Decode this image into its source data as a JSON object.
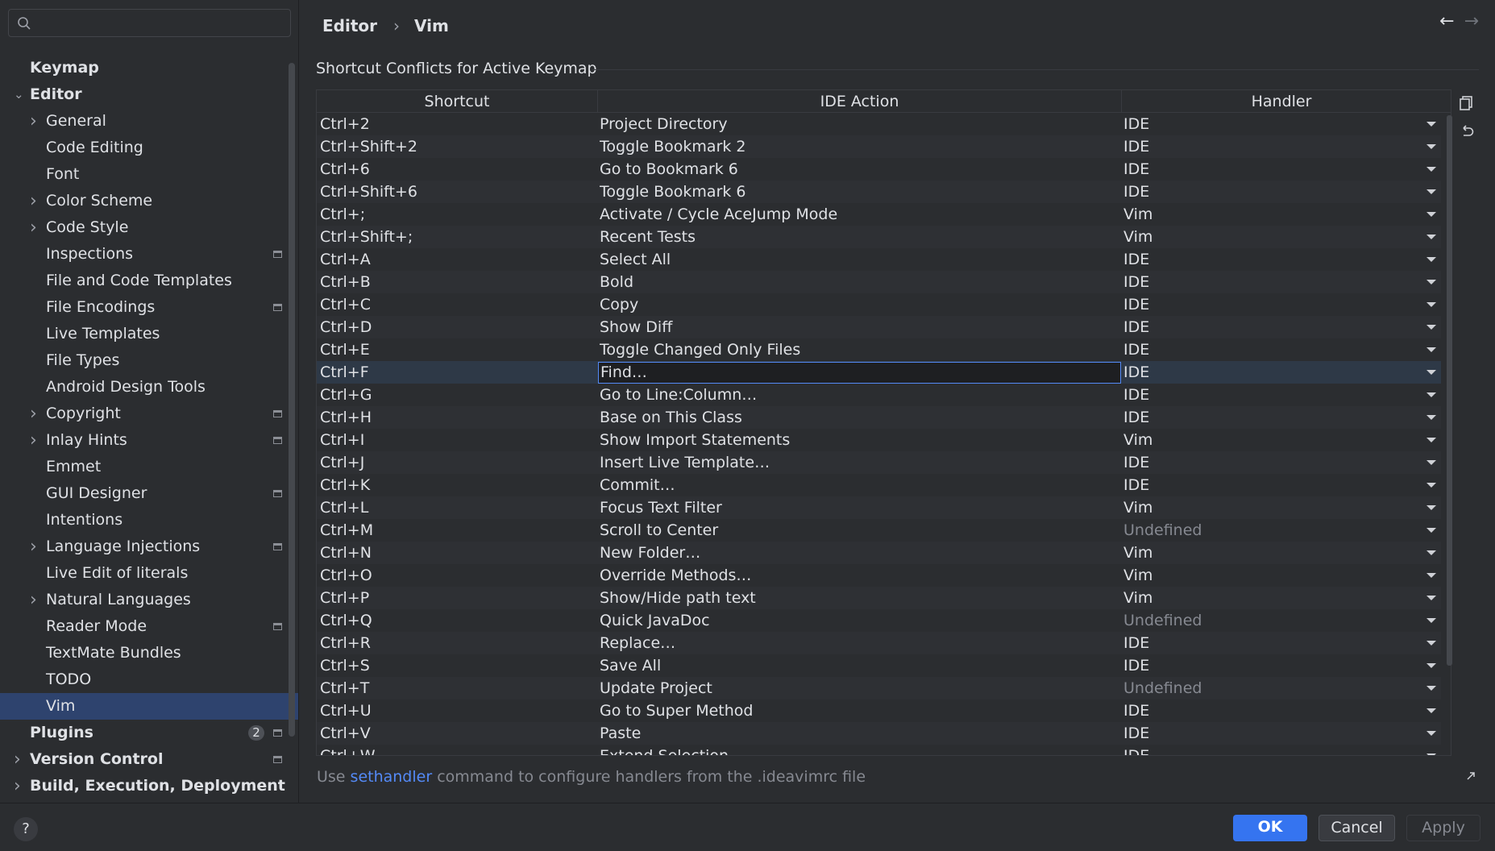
{
  "search": {
    "placeholder": ""
  },
  "sidebar": {
    "items": [
      {
        "label": "Keymap",
        "bold": true,
        "indent": 0,
        "chevron": "",
        "project_icon": false,
        "badge": ""
      },
      {
        "label": "Editor",
        "bold": true,
        "indent": 0,
        "chevron": "expanded",
        "project_icon": false,
        "badge": ""
      },
      {
        "label": "General",
        "bold": false,
        "indent": 1,
        "chevron": "collapsed",
        "project_icon": false,
        "badge": ""
      },
      {
        "label": "Code Editing",
        "bold": false,
        "indent": 1,
        "chevron": "",
        "project_icon": false,
        "badge": ""
      },
      {
        "label": "Font",
        "bold": false,
        "indent": 1,
        "chevron": "",
        "project_icon": false,
        "badge": ""
      },
      {
        "label": "Color Scheme",
        "bold": false,
        "indent": 1,
        "chevron": "collapsed",
        "project_icon": false,
        "badge": ""
      },
      {
        "label": "Code Style",
        "bold": false,
        "indent": 1,
        "chevron": "collapsed",
        "project_icon": false,
        "badge": ""
      },
      {
        "label": "Inspections",
        "bold": false,
        "indent": 1,
        "chevron": "",
        "project_icon": true,
        "badge": ""
      },
      {
        "label": "File and Code Templates",
        "bold": false,
        "indent": 1,
        "chevron": "",
        "project_icon": false,
        "badge": ""
      },
      {
        "label": "File Encodings",
        "bold": false,
        "indent": 1,
        "chevron": "",
        "project_icon": true,
        "badge": ""
      },
      {
        "label": "Live Templates",
        "bold": false,
        "indent": 1,
        "chevron": "",
        "project_icon": false,
        "badge": ""
      },
      {
        "label": "File Types",
        "bold": false,
        "indent": 1,
        "chevron": "",
        "project_icon": false,
        "badge": ""
      },
      {
        "label": "Android Design Tools",
        "bold": false,
        "indent": 1,
        "chevron": "",
        "project_icon": false,
        "badge": ""
      },
      {
        "label": "Copyright",
        "bold": false,
        "indent": 1,
        "chevron": "collapsed",
        "project_icon": true,
        "badge": ""
      },
      {
        "label": "Inlay Hints",
        "bold": false,
        "indent": 1,
        "chevron": "collapsed",
        "project_icon": true,
        "badge": ""
      },
      {
        "label": "Emmet",
        "bold": false,
        "indent": 1,
        "chevron": "",
        "project_icon": false,
        "badge": ""
      },
      {
        "label": "GUI Designer",
        "bold": false,
        "indent": 1,
        "chevron": "",
        "project_icon": true,
        "badge": ""
      },
      {
        "label": "Intentions",
        "bold": false,
        "indent": 1,
        "chevron": "",
        "project_icon": false,
        "badge": ""
      },
      {
        "label": "Language Injections",
        "bold": false,
        "indent": 1,
        "chevron": "collapsed",
        "project_icon": true,
        "badge": ""
      },
      {
        "label": "Live Edit of literals",
        "bold": false,
        "indent": 1,
        "chevron": "",
        "project_icon": false,
        "badge": ""
      },
      {
        "label": "Natural Languages",
        "bold": false,
        "indent": 1,
        "chevron": "collapsed",
        "project_icon": false,
        "badge": ""
      },
      {
        "label": "Reader Mode",
        "bold": false,
        "indent": 1,
        "chevron": "",
        "project_icon": true,
        "badge": ""
      },
      {
        "label": "TextMate Bundles",
        "bold": false,
        "indent": 1,
        "chevron": "",
        "project_icon": false,
        "badge": ""
      },
      {
        "label": "TODO",
        "bold": false,
        "indent": 1,
        "chevron": "",
        "project_icon": false,
        "badge": ""
      },
      {
        "label": "Vim",
        "bold": false,
        "indent": 1,
        "chevron": "",
        "project_icon": false,
        "badge": "",
        "selected": true
      },
      {
        "label": "Plugins",
        "bold": true,
        "indent": 0,
        "chevron": "",
        "project_icon": true,
        "badge": "2"
      },
      {
        "label": "Version Control",
        "bold": true,
        "indent": 0,
        "chevron": "collapsed",
        "project_icon": true,
        "badge": ""
      },
      {
        "label": "Build, Execution, Deployment",
        "bold": true,
        "indent": 0,
        "chevron": "collapsed",
        "project_icon": false,
        "badge": ""
      }
    ]
  },
  "breadcrumb": {
    "parent": "Editor",
    "separator": "›",
    "current": "Vim"
  },
  "nav": {
    "back": "←",
    "forward": "→"
  },
  "section": {
    "title": "Shortcut Conflicts for Active Keymap"
  },
  "table": {
    "headers": [
      "Shortcut",
      "IDE Action",
      "Handler"
    ],
    "rows": [
      {
        "shortcut": "Ctrl+2",
        "action": "Project Directory",
        "handler": "IDE"
      },
      {
        "shortcut": "Ctrl+Shift+2",
        "action": "Toggle Bookmark 2",
        "handler": "IDE"
      },
      {
        "shortcut": "Ctrl+6",
        "action": "Go to Bookmark 6",
        "handler": "IDE"
      },
      {
        "shortcut": "Ctrl+Shift+6",
        "action": "Toggle Bookmark 6",
        "handler": "IDE"
      },
      {
        "shortcut": "Ctrl+;",
        "action": "Activate / Cycle AceJump Mode",
        "handler": "Vim"
      },
      {
        "shortcut": "Ctrl+Shift+;",
        "action": "Recent Tests",
        "handler": "Vim"
      },
      {
        "shortcut": "Ctrl+A",
        "action": "Select All",
        "handler": "IDE"
      },
      {
        "shortcut": "Ctrl+B",
        "action": "Bold",
        "handler": "IDE"
      },
      {
        "shortcut": "Ctrl+C",
        "action": "Copy",
        "handler": "IDE"
      },
      {
        "shortcut": "Ctrl+D",
        "action": "Show Diff",
        "handler": "IDE"
      },
      {
        "shortcut": "Ctrl+E",
        "action": "Toggle Changed Only Files",
        "handler": "IDE"
      },
      {
        "shortcut": "Ctrl+F",
        "action": "Find…",
        "handler": "IDE",
        "selected": true
      },
      {
        "shortcut": "Ctrl+G",
        "action": "Go to Line:Column…",
        "handler": "IDE"
      },
      {
        "shortcut": "Ctrl+H",
        "action": "Base on This Class",
        "handler": "IDE"
      },
      {
        "shortcut": "Ctrl+I",
        "action": "Show Import Statements",
        "handler": "Vim"
      },
      {
        "shortcut": "Ctrl+J",
        "action": "Insert Live Template…",
        "handler": "IDE"
      },
      {
        "shortcut": "Ctrl+K",
        "action": "Commit…",
        "handler": "IDE"
      },
      {
        "shortcut": "Ctrl+L",
        "action": "Focus Text Filter",
        "handler": "Vim"
      },
      {
        "shortcut": "Ctrl+M",
        "action": "Scroll to Center",
        "handler": "Undefined"
      },
      {
        "shortcut": "Ctrl+N",
        "action": "New Folder…",
        "handler": "Vim"
      },
      {
        "shortcut": "Ctrl+O",
        "action": "Override Methods…",
        "handler": "Vim"
      },
      {
        "shortcut": "Ctrl+P",
        "action": "Show/Hide path text",
        "handler": "Vim"
      },
      {
        "shortcut": "Ctrl+Q",
        "action": "Quick JavaDoc",
        "handler": "Undefined"
      },
      {
        "shortcut": "Ctrl+R",
        "action": "Replace…",
        "handler": "IDE"
      },
      {
        "shortcut": "Ctrl+S",
        "action": "Save All",
        "handler": "IDE"
      },
      {
        "shortcut": "Ctrl+T",
        "action": "Update Project",
        "handler": "Undefined"
      },
      {
        "shortcut": "Ctrl+U",
        "action": "Go to Super Method",
        "handler": "IDE"
      },
      {
        "shortcut": "Ctrl+V",
        "action": "Paste",
        "handler": "IDE"
      },
      {
        "shortcut": "Ctrl+W",
        "action": "Extend Selection",
        "handler": "IDE"
      }
    ]
  },
  "hint": {
    "prefix": "Use ",
    "link": "sethandler",
    "suffix": " command to configure handlers from the .ideavimrc file"
  },
  "footer": {
    "help": "?",
    "ok": "OK",
    "cancel": "Cancel",
    "apply": "Apply"
  },
  "colors": {
    "accent": "#3574f0",
    "link": "#548af7",
    "selection": "#2e436e",
    "background": "#2b2d30"
  }
}
